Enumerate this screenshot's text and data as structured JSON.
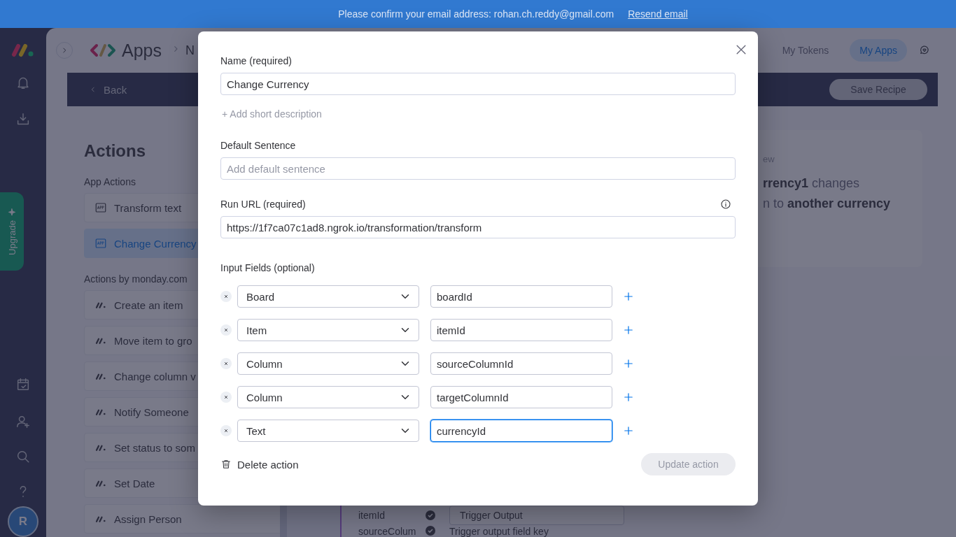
{
  "banner": {
    "message": "Please confirm your email address: rohan.ch.reddy@gmail.com",
    "link": "Resend email"
  },
  "rail": {
    "upgrade": "Upgrade",
    "avatar": "R"
  },
  "header": {
    "title": "Apps",
    "breadcrumb": "N",
    "tabs": [
      {
        "label": "My Tokens",
        "selected": false
      },
      {
        "label": "My Apps",
        "selected": true
      }
    ]
  },
  "toolbar": {
    "back": "Back",
    "save": "Save Recipe"
  },
  "actions": {
    "title": "Actions",
    "groups": [
      {
        "heading": "App Actions",
        "items": [
          {
            "label": "Transform text",
            "kind": "app",
            "selected": false
          },
          {
            "label": "Change Currency",
            "kind": "app",
            "selected": true
          }
        ]
      },
      {
        "heading": "Actions by monday.com",
        "items": [
          {
            "label": "Create an item",
            "kind": "monday",
            "selected": false
          },
          {
            "label": "Move item to gro",
            "kind": "monday",
            "selected": false
          },
          {
            "label": "Change column v",
            "kind": "monday",
            "selected": false
          },
          {
            "label": "Notify Someone",
            "kind": "monday",
            "selected": false
          },
          {
            "label": "Set status to som",
            "kind": "monday",
            "selected": false
          },
          {
            "label": "Set Date",
            "kind": "monday",
            "selected": false
          },
          {
            "label": "Assign Person",
            "kind": "monday",
            "selected": false
          }
        ]
      }
    ]
  },
  "recipe_fields": [
    {
      "name": "itemId",
      "kind": "field",
      "value": "Trigger Output"
    },
    {
      "name": "sourceColum",
      "kind": "text",
      "value": "Trigger output field key"
    }
  ],
  "preview": {
    "label": "ew",
    "lines": [
      "**rrency1** changes",
      "n to **another currency**"
    ]
  },
  "modal": {
    "name_label": "Name (required)",
    "name_value": "Change Currency",
    "add_description": "+ Add short description",
    "sentence_label": "Default Sentence",
    "sentence_placeholder": "Add default sentence",
    "url_label": "Run URL (required)",
    "url_value": "https://1f7ca07c1ad8.ngrok.io/transformation/transform",
    "input_fields_label": "Input Fields (optional)",
    "input_fields": [
      {
        "type": "Board",
        "key": "boardId",
        "focused": false
      },
      {
        "type": "Item",
        "key": "itemId",
        "focused": false
      },
      {
        "type": "Column",
        "key": "sourceColumnId",
        "focused": false
      },
      {
        "type": "Column",
        "key": "targetColumnId",
        "focused": false
      },
      {
        "type": "Text",
        "key": "currencyId",
        "focused": true
      }
    ],
    "delete": "Delete action",
    "update": {
      "label": "Update action",
      "disabled": true
    }
  }
}
